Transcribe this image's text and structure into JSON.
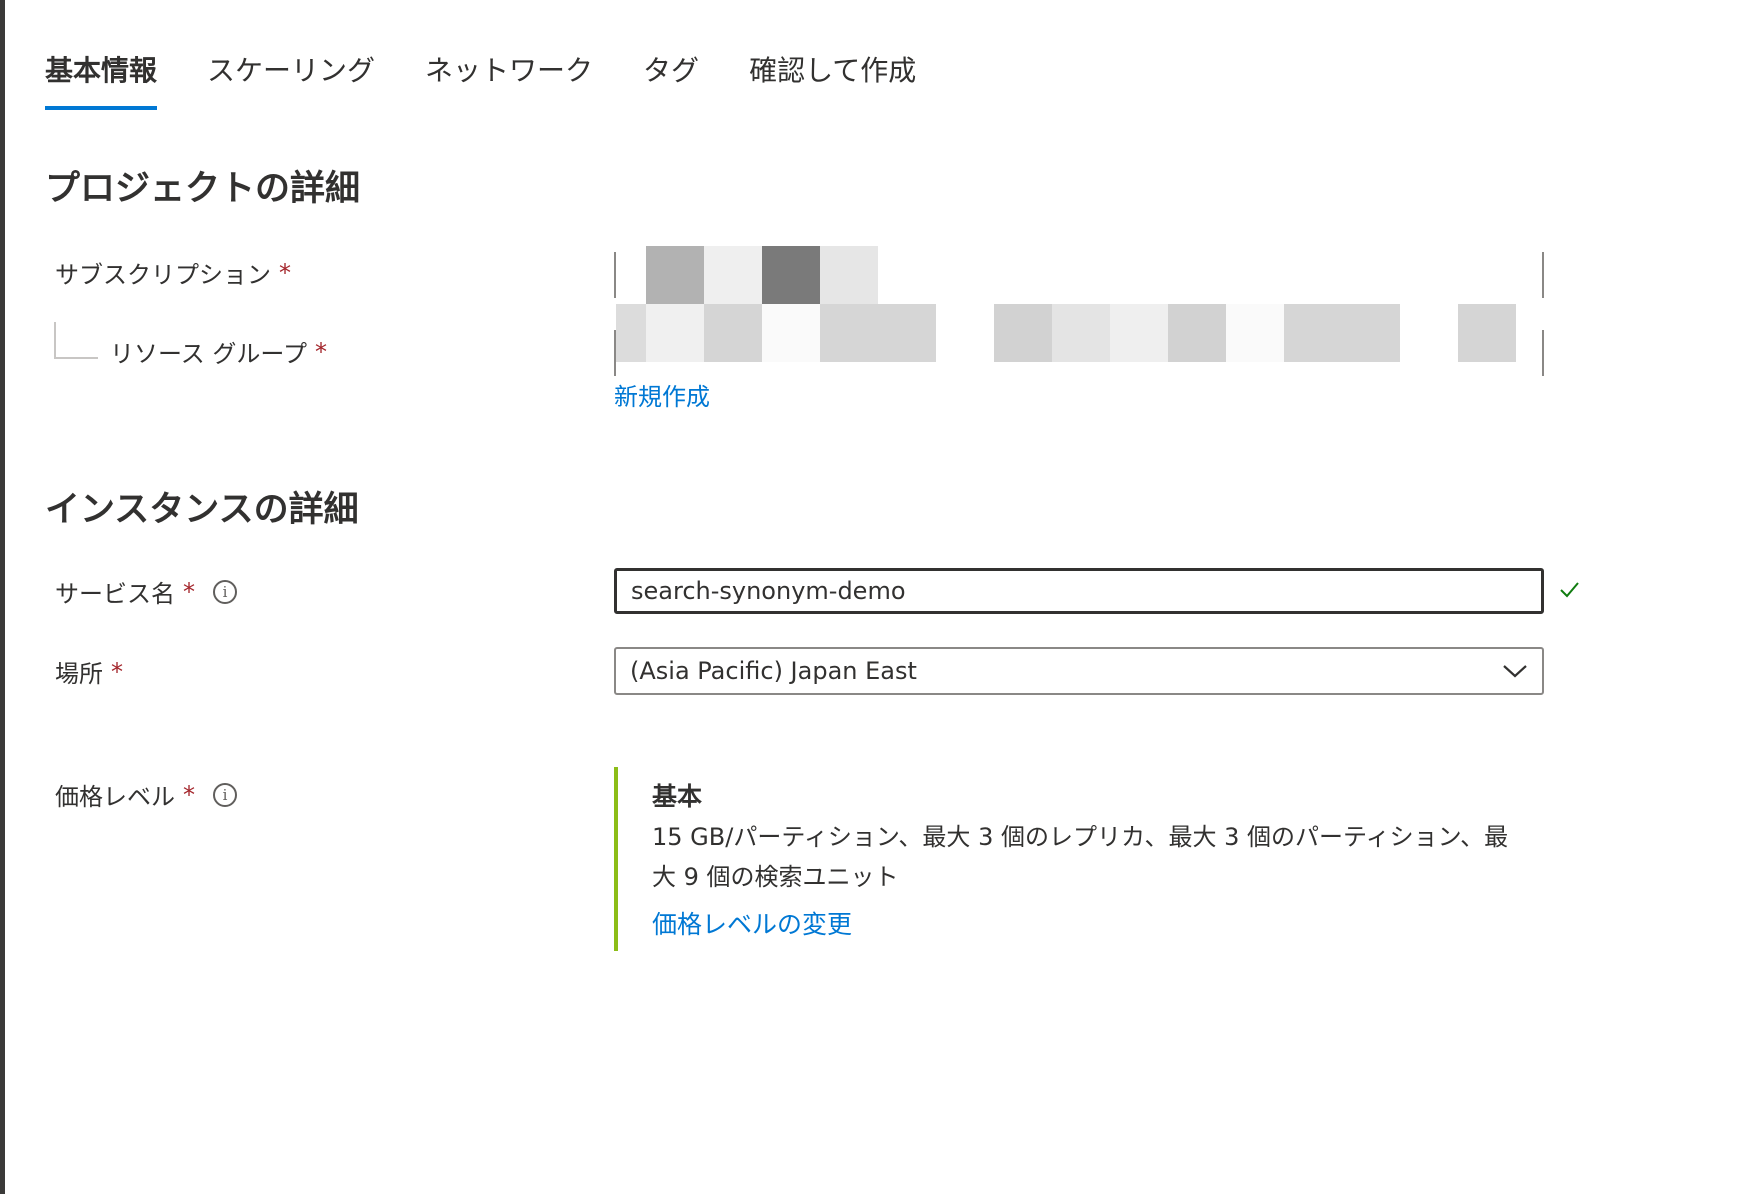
{
  "tabs": [
    {
      "label": "基本情報",
      "active": true
    },
    {
      "label": "スケーリング",
      "active": false
    },
    {
      "label": "ネットワーク",
      "active": false
    },
    {
      "label": "タグ",
      "active": false
    },
    {
      "label": "確認して作成",
      "active": false
    }
  ],
  "project_details": {
    "title": "プロジェクトの詳細",
    "subscription_label": "サブスクリプション",
    "resource_group_label": "リソース グループ",
    "required_mark": "*",
    "create_new_link": "新規作成"
  },
  "instance_details": {
    "title": "インスタンスの詳細",
    "service_name_label": "サービス名",
    "service_name_value": "search-synonym-demo",
    "location_label": "場所",
    "location_value": "(Asia Pacific) Japan East",
    "required_mark": "*",
    "info_icon_glyph": "i"
  },
  "pricing": {
    "label": "価格レベル",
    "tier_name": "基本",
    "tier_description": "15 GB/パーティション、最大 3 個のレプリカ、最大 3 個のパーティション、最大 9 個の検索ユニット",
    "change_link": "価格レベルの変更"
  },
  "colors": {
    "accent": "#0078d4",
    "required": "#a4262c",
    "tier_bar": "#8cbd18",
    "valid_check": "#107c10"
  }
}
